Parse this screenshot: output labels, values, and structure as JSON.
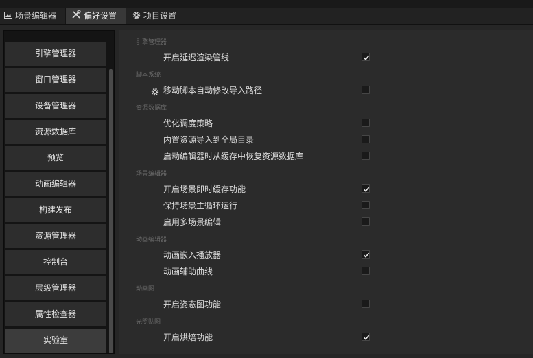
{
  "tabs": [
    {
      "label": "场景编辑器",
      "icon": "scene-editor-icon"
    },
    {
      "label": "偏好设置",
      "icon": "tools-icon"
    },
    {
      "label": "项目设置",
      "icon": "gear-icon"
    }
  ],
  "active_tab": 1,
  "sidebar": {
    "items": [
      "引擎管理器",
      "窗口管理器",
      "设备管理器",
      "资源数据库",
      "预览",
      "动画编辑器",
      "构建发布",
      "资源管理器",
      "控制台",
      "层级管理器",
      "属性检查器",
      "实验室"
    ],
    "active_index": 11
  },
  "sections": {
    "engine": {
      "title": "引擎管理器",
      "opt0": "开启延迟渲染管线",
      "opt0_checked": true
    },
    "script": {
      "title": "脚本系统",
      "opt0": "移动脚本自动修改导入路径",
      "opt0_checked": false
    },
    "asset_db": {
      "title": "资源数据库",
      "opt0": "优化调度策略",
      "opt0_checked": false,
      "opt1": "内置资源导入到全局目录",
      "opt1_checked": false,
      "opt2": "启动编辑器时从缓存中恢复资源数据库",
      "opt2_checked": false
    },
    "scene_editor": {
      "title": "场景编辑器",
      "opt0": "开启场景即时缓存功能",
      "opt0_checked": true,
      "opt1": "保持场景主循环运行",
      "opt1_checked": false,
      "opt2": "启用多场景编辑",
      "opt2_checked": false
    },
    "anim_editor": {
      "title": "动画编辑器",
      "opt0": "动画嵌入播放器",
      "opt0_checked": true,
      "opt1": "动画辅助曲线",
      "opt1_checked": false
    },
    "anim_graph": {
      "title": "动画图",
      "opt0": "开启姿态图功能",
      "opt0_checked": false
    },
    "lightmap": {
      "title": "光照贴图",
      "opt0": "开启烘焙功能",
      "opt0_checked": true
    }
  }
}
